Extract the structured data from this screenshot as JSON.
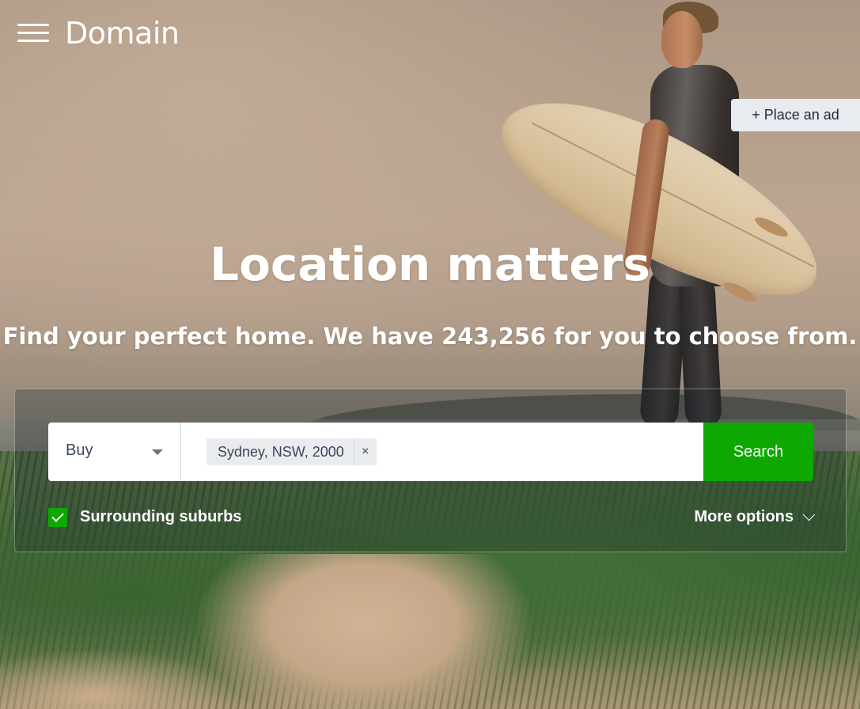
{
  "header": {
    "logo_text": "Domain",
    "place_ad_label": "+ Place an ad"
  },
  "hero": {
    "headline": "Location matters",
    "subline": "Find your perfect home. We have 243,256 for you to choose from."
  },
  "search": {
    "listing_type": "Buy",
    "location_chip": "Sydney, NSW, 2000",
    "chip_remove_symbol": "×",
    "search_button_label": "Search",
    "surrounding_suburbs_label": "Surrounding suburbs",
    "surrounding_suburbs_checked": true,
    "more_options_label": "More options"
  },
  "colors": {
    "accent_green": "#0ea800",
    "text_dark": "#3c475b",
    "place_ad_bg": "#e8ebef"
  },
  "icons": {
    "menu": "hamburger-menu-icon",
    "dropdown": "caret-down-icon",
    "close": "close-icon",
    "check": "checkmark-icon",
    "expand": "chevron-down-icon"
  }
}
